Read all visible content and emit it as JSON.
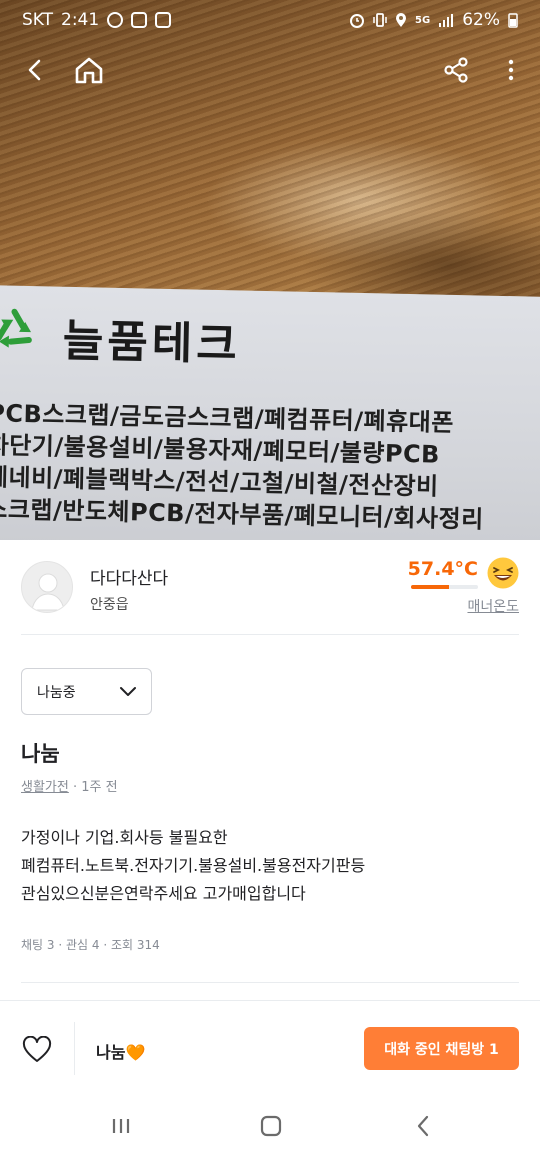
{
  "status_bar": {
    "carrier": "SKT",
    "time": "2:41",
    "battery": "62%",
    "network": "5G"
  },
  "photo": {
    "brand_text": "늘품테크",
    "lines": [
      "PCB스크랩/금도금스크랩/폐컴퓨터/폐휴대폰",
      "차단기/불용설비/불용자재/폐모터/불량PCB",
      "폐네비/폐블랙박스/전선/고철/비철/전산장비",
      "스크랩/반도체PCB/전자부품/폐모니터/회사정리"
    ]
  },
  "seller": {
    "name": "다다다산다",
    "location": "안중읍",
    "temperature": "57.4°C",
    "temperature_level": 0.574,
    "manner_label": "매너온도",
    "accent": "#f76707"
  },
  "post": {
    "status": "나눔중",
    "title": "나눔",
    "category": "생활가전",
    "time_ago": "1주 전",
    "meta_sep": " · ",
    "body_lines": [
      "가정이나 기업.회사등 불필요한",
      "폐컴퓨터.노트북.전자기기.불용설비.불용전자기판등",
      "관심있으신분은연락주세요 고가매입합니다"
    ],
    "stats": "채팅 3 · 관심 4 · 조회 314"
  },
  "action_bar": {
    "price": "나눔🧡",
    "chat_button": "대화 중인 채팅방 1",
    "button_color": "#ff7e36"
  },
  "icons": {
    "back": "back-arrow-icon",
    "home": "home-icon",
    "share": "share-icon",
    "more": "more-vertical-icon",
    "heart": "heart-icon",
    "chevron": "chevron-down-icon",
    "smile": "smiling-face-icon"
  }
}
